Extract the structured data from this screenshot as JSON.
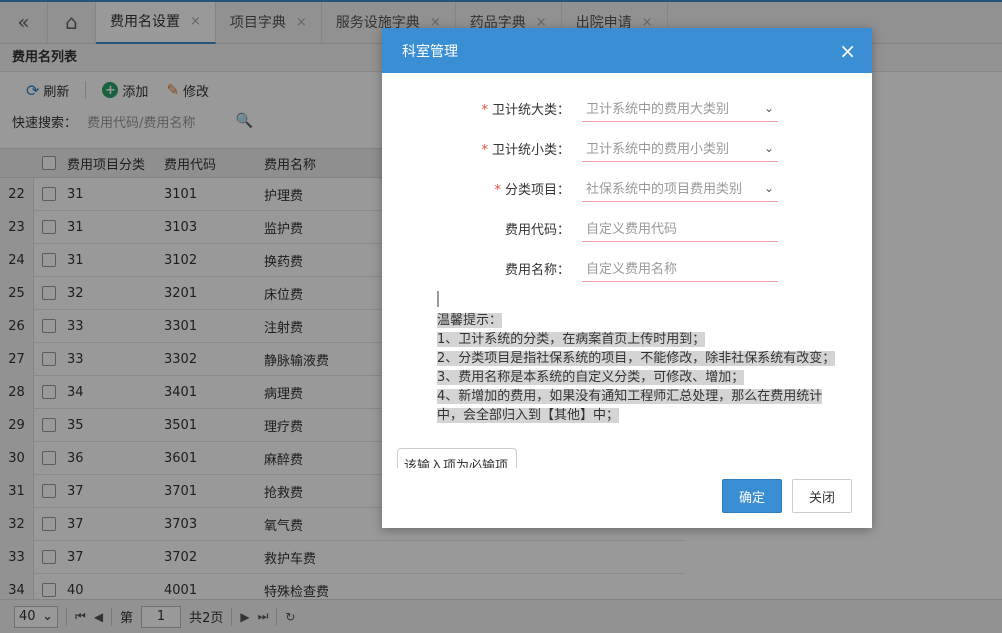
{
  "tabs": {
    "items": [
      {
        "label": "费用名设置",
        "close": "×"
      },
      {
        "label": "项目字典",
        "close": "×"
      },
      {
        "label": "服务设施字典",
        "close": "×"
      },
      {
        "label": "药品字典",
        "close": "×"
      },
      {
        "label": "出院申请",
        "close": "×"
      }
    ]
  },
  "panel": {
    "title": "费用名列表",
    "toolbar": {
      "refresh": "刷新",
      "add": "添加",
      "edit": "修改"
    },
    "search": {
      "label": "快速搜索：",
      "placeholder": "费用代码/费用名称"
    }
  },
  "grid": {
    "columns": [
      "费用项目分类",
      "费用代码",
      "费用名称"
    ],
    "rows": [
      {
        "idx": "22",
        "cat": "31",
        "code": "3101",
        "name": "护理费"
      },
      {
        "idx": "23",
        "cat": "31",
        "code": "3103",
        "name": "监护费"
      },
      {
        "idx": "24",
        "cat": "31",
        "code": "3102",
        "name": "换药费"
      },
      {
        "idx": "25",
        "cat": "32",
        "code": "3201",
        "name": "床位费"
      },
      {
        "idx": "26",
        "cat": "33",
        "code": "3301",
        "name": "注射费"
      },
      {
        "idx": "27",
        "cat": "33",
        "code": "3302",
        "name": "静脉输液费"
      },
      {
        "idx": "28",
        "cat": "34",
        "code": "3401",
        "name": "病理费"
      },
      {
        "idx": "29",
        "cat": "35",
        "code": "3501",
        "name": "理疗费"
      },
      {
        "idx": "30",
        "cat": "36",
        "code": "3601",
        "name": "麻醉费"
      },
      {
        "idx": "31",
        "cat": "37",
        "code": "3701",
        "name": "抢救费"
      },
      {
        "idx": "32",
        "cat": "37",
        "code": "3703",
        "name": "氧气费"
      },
      {
        "idx": "33",
        "cat": "37",
        "code": "3702",
        "name": "救护车费"
      },
      {
        "idx": "34",
        "cat": "40",
        "code": "4001",
        "name": "特殊检查费"
      }
    ]
  },
  "pager": {
    "page_size": "40",
    "page_label": "第",
    "page_value": "1",
    "total_label": "共2页"
  },
  "modal": {
    "title": "科室管理",
    "close": "×",
    "fields": [
      {
        "label": "卫计统大类：",
        "required": true,
        "placeholder": "卫计系统中的费用大类别",
        "dropdown": true
      },
      {
        "label": "卫计统小类：",
        "required": true,
        "placeholder": "卫计系统中的费用小类别",
        "dropdown": true
      },
      {
        "label": "分类项目：",
        "required": true,
        "placeholder": "社保系统中的项目费用类别",
        "dropdown": true
      },
      {
        "label": "费用代码：",
        "required": false,
        "placeholder": "自定义费用代码",
        "dropdown": false
      },
      {
        "label": "费用名称：",
        "required": false,
        "placeholder": "自定义费用名称",
        "dropdown": false
      }
    ],
    "notice": [
      "温馨提示：",
      "1、卫计系统的分类，在病案首页上传时用到；",
      "2、分类项目是指社保系统的项目，不能修改，除非社保系统有改变；",
      "3、费用名称是本系统的自定义分类，可修改、增加；",
      "4、新增加的费用，如果没有通知工程师汇总处理，那么在费用统计中，会全部归入到【其他】中；"
    ],
    "tooltip": "该输入项为必输项",
    "ok": "确定",
    "cancel": "关闭"
  }
}
